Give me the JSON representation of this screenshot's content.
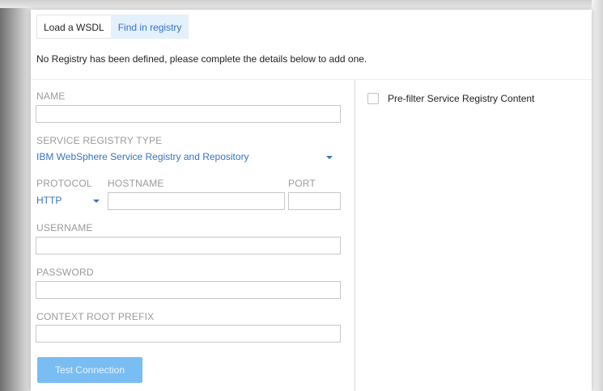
{
  "tabs": [
    {
      "label": "Load a WSDL",
      "active": false
    },
    {
      "label": "Find in registry",
      "active": true
    }
  ],
  "notice": "No Registry has been defined, please complete the details below to add one.",
  "form": {
    "name": {
      "label": "NAME",
      "value": ""
    },
    "registry_type": {
      "label": "SERVICE REGISTRY TYPE",
      "selected": "IBM WebSphere Service Registry and Repository"
    },
    "protocol": {
      "label": "PROTOCOL",
      "selected": "HTTP"
    },
    "hostname": {
      "label": "HOSTNAME",
      "value": ""
    },
    "port": {
      "label": "PORT",
      "value": ""
    },
    "username": {
      "label": "USERNAME",
      "value": ""
    },
    "password": {
      "label": "PASSWORD",
      "value": ""
    },
    "context_root": {
      "label": "CONTEXT ROOT PREFIX",
      "value": ""
    },
    "test_button": {
      "label": "Test Connection",
      "enabled": false
    }
  },
  "prefilter": {
    "label": "Pre-filter Service Registry Content",
    "checked": false
  },
  "colors": {
    "accent": "#3573c4",
    "active_tab_bg": "#e4f0fb",
    "disabled_button": "#79bdf2",
    "label_gray": "#9a9a9a"
  },
  "icons": {
    "dropdown": "chevron-down-icon"
  }
}
